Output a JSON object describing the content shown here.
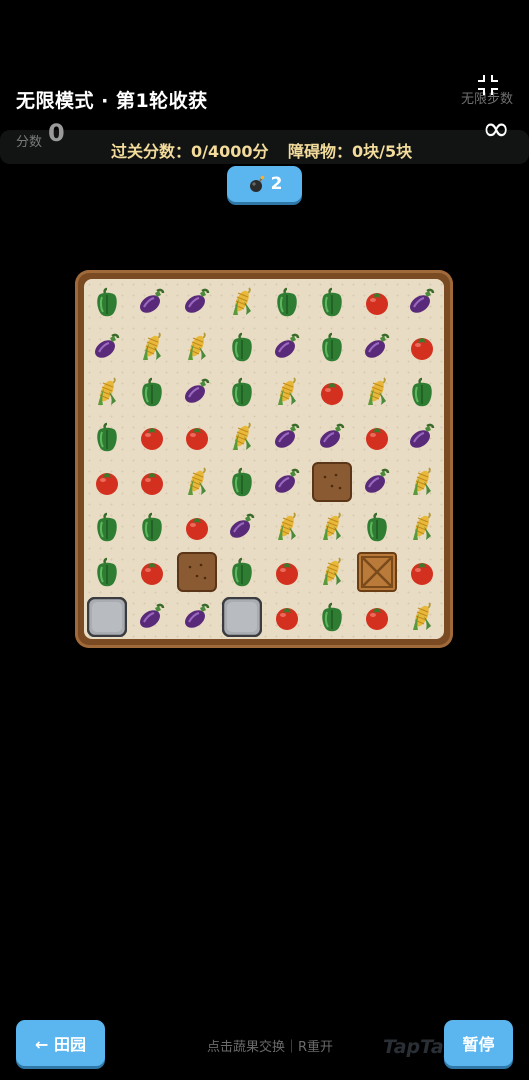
{
  "header": {
    "title": "无限模式 · 第1轮收获",
    "moves_label": "无限步数",
    "moves_value": "∞",
    "score_label": "分数",
    "score_value": "0",
    "target_label": "过关分数：0/4000分",
    "obstacle_label": "障碍物：0块/5块"
  },
  "bomb": {
    "icon": "bomb-icon",
    "count": "2"
  },
  "board": {
    "rows": 8,
    "cols": 8,
    "grid": [
      [
        "pepper",
        "eggplant",
        "eggplant",
        "corn",
        "pepper",
        "pepper",
        "tomato",
        "eggplant"
      ],
      [
        "eggplant",
        "corn",
        "corn",
        "pepper",
        "eggplant",
        "pepper",
        "eggplant",
        "tomato"
      ],
      [
        "corn",
        "pepper",
        "eggplant",
        "pepper",
        "corn",
        "tomato",
        "corn",
        "pepper"
      ],
      [
        "pepper",
        "tomato",
        "tomato",
        "corn",
        "eggplant",
        "eggplant",
        "tomato",
        "eggplant"
      ],
      [
        "tomato",
        "tomato",
        "corn",
        "pepper",
        "eggplant",
        "dirt",
        "eggplant",
        "corn"
      ],
      [
        "pepper",
        "pepper",
        "tomato",
        "eggplant",
        "corn",
        "corn",
        "pepper",
        "corn"
      ],
      [
        "pepper",
        "tomato",
        "dirt",
        "pepper",
        "tomato",
        "corn",
        "crate",
        "tomato"
      ],
      [
        "stone",
        "eggplant",
        "eggplant",
        "stone",
        "tomato",
        "pepper",
        "tomato",
        "corn"
      ]
    ]
  },
  "footer": {
    "back_label": "← 田园",
    "hint": "点击蔬果交换｜R重开",
    "watermark": "TapTap",
    "pause_label": "暂停"
  },
  "colors": {
    "button_blue": "#5bb5ee",
    "target_text": "#f3dc9b",
    "board_frame": "#7a4b23",
    "board_bg": "#e8dcc4"
  }
}
